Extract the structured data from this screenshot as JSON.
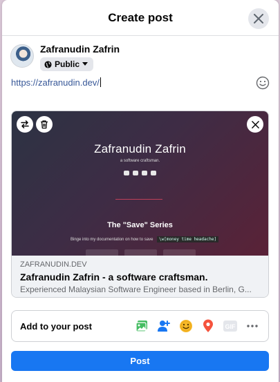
{
  "header": {
    "title": "Create post"
  },
  "user": {
    "name": "Zafranudin Zafrin",
    "privacy": "Public"
  },
  "composer": {
    "text": "https://zafranudin.dev/"
  },
  "link_preview": {
    "site_name": "Zafranudin Zafrin",
    "site_tagline": "a software craftsman.",
    "series_title": "The \"Save\" Series",
    "series_caption": "Binge into my documentation on how to save",
    "series_code": "\\w[money time headache]",
    "domain": "ZAFRANUDIN.DEV",
    "title": "Zafranudin Zafrin - a software craftsman.",
    "description": "Experienced Malaysian Software Engineer based in Berlin, G..."
  },
  "add_to_post": {
    "label": "Add to your post",
    "icons": [
      "photo-video-icon",
      "tag-people-icon",
      "feeling-icon",
      "check-in-icon",
      "gif-icon",
      "more-icon"
    ],
    "gif_label": "GIF"
  },
  "post_button": {
    "label": "Post"
  },
  "colors": {
    "accent": "#1877f2",
    "link": "#385898",
    "photo": "#45bd62",
    "tag": "#1877f2",
    "feeling": "#f7b928",
    "checkin": "#f5533d"
  }
}
